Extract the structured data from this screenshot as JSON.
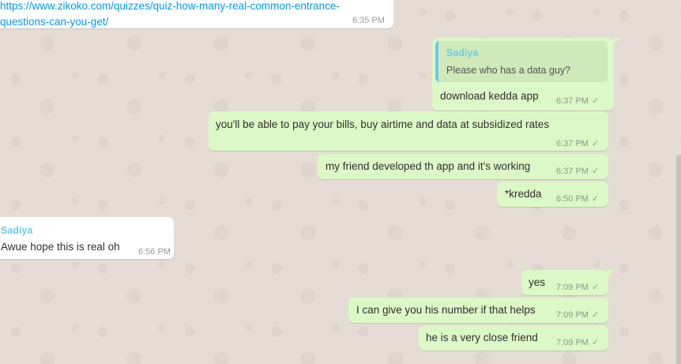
{
  "messages": [
    {
      "type": "in",
      "link_line1": "https://www.zikoko.com/quizzes/quiz-how-many-real-common-entrance-",
      "link_line2": "questions-can-you-get/",
      "time": "6:35 PM"
    },
    {
      "type": "out",
      "quote_sender": "Sadiya",
      "quote_text": "Please who has a data guy?",
      "text": "download kedda app",
      "time": "6:37 PM"
    },
    {
      "type": "out",
      "text": "you'll be able to pay your bills, buy airtime and data at subsidized rates",
      "time": "6:37 PM"
    },
    {
      "type": "out",
      "text": "my friend developed th app and it's working",
      "time": "6:37 PM"
    },
    {
      "type": "out",
      "text": "*kredda",
      "time": "6:50 PM"
    },
    {
      "type": "in",
      "sender": "Sadiya",
      "text": "Awue hope this is real oh",
      "time": "6:56 PM"
    },
    {
      "type": "out",
      "text": "yes",
      "time": "7:09 PM"
    },
    {
      "type": "out",
      "text": "I can give you his number if that helps",
      "time": "7:09 PM"
    },
    {
      "type": "out",
      "text": "he is a very  close friend",
      "time": "7:09 PM"
    }
  ],
  "tick_glyph": "✓",
  "colors": {
    "outgoing_bubble": "#dcf8c6",
    "incoming_bubble": "#ffffff",
    "sender_name": "#6bcbef",
    "link": "#039be5",
    "background": "#e5ddd5"
  }
}
